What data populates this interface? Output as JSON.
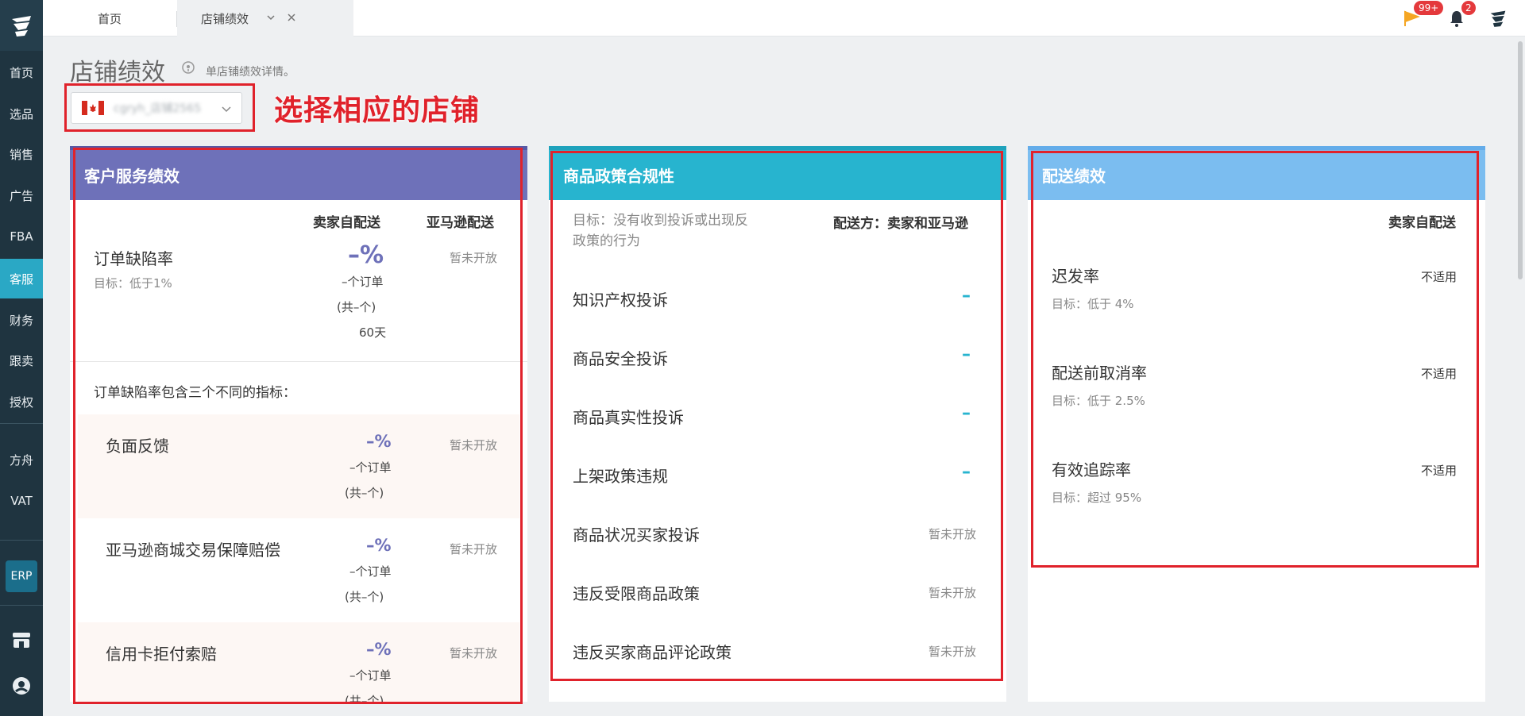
{
  "sidebar": {
    "items": [
      {
        "label": "首页"
      },
      {
        "label": "选品"
      },
      {
        "label": "销售"
      },
      {
        "label": "广告"
      },
      {
        "label": "FBA"
      },
      {
        "label": "客服"
      },
      {
        "label": "财务"
      },
      {
        "label": "跟卖"
      },
      {
        "label": "授权"
      },
      {
        "label": "方舟"
      },
      {
        "label": "VAT"
      }
    ],
    "active": "客服",
    "erp_label": "ERP"
  },
  "tabs": {
    "home": "首页",
    "active": "店铺绩效"
  },
  "topbar": {
    "flag_badge": "99+",
    "bell_badge": "2"
  },
  "page": {
    "title": "店铺绩效",
    "subtitle": "单店铺绩效详情。",
    "store_name": "cgryh_店铺2565...",
    "annotation": "选择相应的店铺"
  },
  "customer_service": {
    "title": "客户服务绩效",
    "col_seller": "卖家自配送",
    "col_amazon": "亚马逊配送",
    "odr": {
      "name": "订单缺陷率",
      "target": "目标：低于1%",
      "value": "–%",
      "orders": "–个订单",
      "total": "(共–个)",
      "days": "60天",
      "amazon": "暂未开放"
    },
    "includes": "订单缺陷率包含三个不同的指标：",
    "sub": [
      {
        "name": "负面反馈",
        "value": "–%",
        "orders": "–个订单",
        "total": "(共–个)",
        "amazon": "暂未开放"
      },
      {
        "name": "亚马逊商城交易保障赔偿",
        "value": "–%",
        "orders": "–个订单",
        "total": "(共–个)",
        "amazon": "暂未开放"
      },
      {
        "name": "信用卡拒付索赔",
        "value": "–%",
        "orders": "–个订单",
        "total": "(共–个)",
        "amazon": "暂未开放"
      }
    ]
  },
  "policy": {
    "title": "商品政策合规性",
    "goal": "目标：没有收到投诉或出现反政策的行为",
    "goal_line1": "目标：没有收到投诉或出现反",
    "goal_line2": "政策的行为",
    "shipper": "配送方：卖家和亚马逊",
    "rows": [
      {
        "name": "知识产权投诉",
        "value": "–"
      },
      {
        "name": "商品安全投诉",
        "value": "–"
      },
      {
        "name": "商品真实性投诉",
        "value": "–"
      },
      {
        "name": "上架政策违规",
        "value": "–"
      },
      {
        "name": "商品状况买家投诉",
        "value": "暂未开放"
      },
      {
        "name": "违反受限商品政策",
        "value": "暂未开放"
      },
      {
        "name": "违反买家商品评论政策",
        "value": "暂未开放"
      }
    ]
  },
  "shipping": {
    "title": "配送绩效",
    "col_seller": "卖家自配送",
    "rows": [
      {
        "name": "迟发率",
        "target": "目标：低于 4%",
        "value": "不适用"
      },
      {
        "name": "配送前取消率",
        "target": "目标：低于 2.5%",
        "value": "不适用"
      },
      {
        "name": "有效追踪率",
        "target": "目标：超过 95%",
        "value": "不适用"
      }
    ]
  }
}
